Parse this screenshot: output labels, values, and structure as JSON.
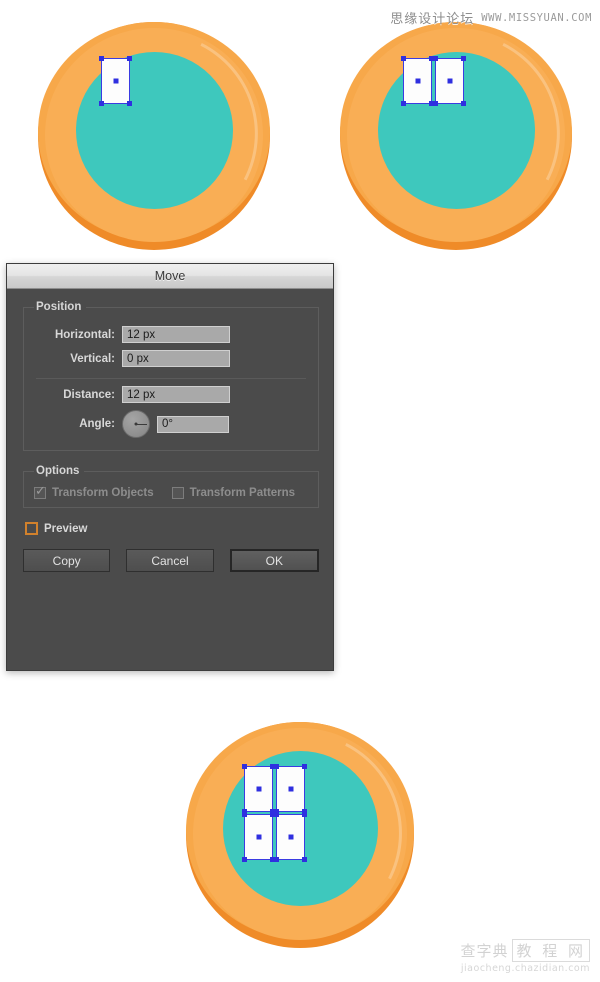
{
  "watermarks": {
    "top_cn": "思缘设计论坛",
    "top_url": "WWW.MISSYUAN.COM",
    "bottom_cn_left": "查字典",
    "bottom_cn_right": "教 程 网",
    "bottom_url": "jiaocheng.chazidian.com"
  },
  "canvas": {
    "colors": {
      "ring_base": "#ef8b28",
      "ring_light": "#f7a84a",
      "ring_highlight": "#f9ae55",
      "face_teal": "#3ec8bd",
      "selection_blue": "#3b3be2",
      "shape_fill": "#fdfdfd"
    },
    "artboards": [
      {
        "name": "step-1-single-rectangle",
        "rect_count": 1
      },
      {
        "name": "step-2-two-rectangles",
        "rect_count": 2
      },
      {
        "name": "step-3-four-rectangles",
        "rect_count": 4
      }
    ]
  },
  "dialog": {
    "title": "Move",
    "position_group": {
      "legend": "Position",
      "fields": [
        {
          "label": "Horizontal:",
          "value": "12 px"
        },
        {
          "label": "Vertical:",
          "value": "0 px"
        },
        {
          "label": "Distance:",
          "value": "12 px"
        },
        {
          "label": "Angle:",
          "value": "0°"
        }
      ]
    },
    "options_group": {
      "legend": "Options",
      "items": [
        {
          "label": "Transform Objects",
          "checked": true,
          "disabled": true
        },
        {
          "label": "Transform Patterns",
          "checked": false,
          "disabled": true
        }
      ]
    },
    "preview": {
      "label": "Preview",
      "checked": false,
      "focus_color": "#d1812c"
    },
    "buttons": [
      {
        "label": "Copy",
        "default": false
      },
      {
        "label": "Cancel",
        "default": false
      },
      {
        "label": "OK",
        "default": true
      }
    ]
  }
}
